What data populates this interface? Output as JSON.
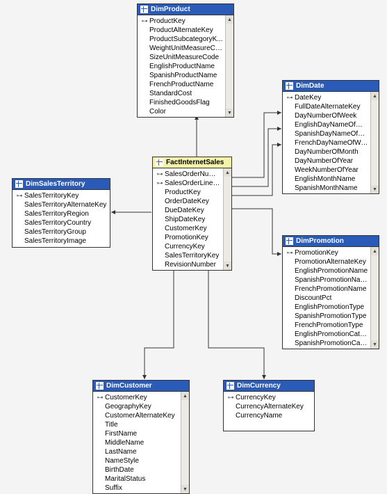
{
  "tables": {
    "dimProduct": {
      "title": "DimProduct",
      "highlight": false,
      "scrollbar": true,
      "columns": [
        {
          "key": true,
          "label": "ProductKey"
        },
        {
          "key": false,
          "label": "ProductAlternateKey"
        },
        {
          "key": false,
          "label": "ProductSubcategoryK..."
        },
        {
          "key": false,
          "label": "WeightUnitMeasureCo..."
        },
        {
          "key": false,
          "label": "SizeUnitMeasureCode"
        },
        {
          "key": false,
          "label": "EnglishProductName"
        },
        {
          "key": false,
          "label": "SpanishProductName"
        },
        {
          "key": false,
          "label": "FrenchProductName"
        },
        {
          "key": false,
          "label": "StandardCost"
        },
        {
          "key": false,
          "label": "FinishedGoodsFlag"
        },
        {
          "key": false,
          "label": "Color"
        }
      ]
    },
    "dimDate": {
      "title": "DimDate",
      "highlight": false,
      "scrollbar": true,
      "columns": [
        {
          "key": true,
          "label": "DateKey"
        },
        {
          "key": false,
          "label": "FullDateAlternateKey"
        },
        {
          "key": false,
          "label": "DayNumberOfWeek"
        },
        {
          "key": false,
          "label": "EnglishDayNameOfWeek"
        },
        {
          "key": false,
          "label": "SpanishDayNameOfWeek"
        },
        {
          "key": false,
          "label": "FrenchDayNameOfWeek"
        },
        {
          "key": false,
          "label": "DayNumberOfMonth"
        },
        {
          "key": false,
          "label": "DayNumberOfYear"
        },
        {
          "key": false,
          "label": "WeekNumberOfYear"
        },
        {
          "key": false,
          "label": "EnglishMonthName"
        },
        {
          "key": false,
          "label": "SpanishMonthName"
        }
      ]
    },
    "dimSalesTerritory": {
      "title": "DimSalesTerritory",
      "highlight": false,
      "scrollbar": false,
      "columns": [
        {
          "key": true,
          "label": "SalesTerritoryKey"
        },
        {
          "key": false,
          "label": "SalesTerritoryAlternateKey"
        },
        {
          "key": false,
          "label": "SalesTerritoryRegion"
        },
        {
          "key": false,
          "label": "SalesTerritoryCountry"
        },
        {
          "key": false,
          "label": "SalesTerritoryGroup"
        },
        {
          "key": false,
          "label": "SalesTerritoryImage"
        }
      ]
    },
    "factInternetSales": {
      "title": "FactInternetSales",
      "highlight": true,
      "scrollbar": true,
      "columns": [
        {
          "key": true,
          "label": "SalesOrderNumber"
        },
        {
          "key": true,
          "label": "SalesOrderLineNum..."
        },
        {
          "key": false,
          "label": "ProductKey"
        },
        {
          "key": false,
          "label": "OrderDateKey"
        },
        {
          "key": false,
          "label": "DueDateKey"
        },
        {
          "key": false,
          "label": "ShipDateKey"
        },
        {
          "key": false,
          "label": "CustomerKey"
        },
        {
          "key": false,
          "label": "PromotionKey"
        },
        {
          "key": false,
          "label": "CurrencyKey"
        },
        {
          "key": false,
          "label": "SalesTerritoryKey"
        },
        {
          "key": false,
          "label": "RevisionNumber"
        }
      ]
    },
    "dimPromotion": {
      "title": "DimPromotion",
      "highlight": false,
      "scrollbar": true,
      "columns": [
        {
          "key": true,
          "label": "PromotionKey"
        },
        {
          "key": false,
          "label": "PromotionAlternateKey"
        },
        {
          "key": false,
          "label": "EnglishPromotionName"
        },
        {
          "key": false,
          "label": "SpanishPromotionName"
        },
        {
          "key": false,
          "label": "FrenchPromotionName"
        },
        {
          "key": false,
          "label": "DiscountPct"
        },
        {
          "key": false,
          "label": "EnglishPromotionType"
        },
        {
          "key": false,
          "label": "SpanishPromotionType"
        },
        {
          "key": false,
          "label": "FrenchPromotionType"
        },
        {
          "key": false,
          "label": "EnglishPromotionCateg..."
        },
        {
          "key": false,
          "label": "SpanishPromotionCateg"
        }
      ]
    },
    "dimCustomer": {
      "title": "DimCustomer",
      "highlight": false,
      "scrollbar": true,
      "columns": [
        {
          "key": true,
          "label": "CustomerKey"
        },
        {
          "key": false,
          "label": "GeographyKey"
        },
        {
          "key": false,
          "label": "CustomerAlternateKey"
        },
        {
          "key": false,
          "label": "Title"
        },
        {
          "key": false,
          "label": "FirstName"
        },
        {
          "key": false,
          "label": "MiddleName"
        },
        {
          "key": false,
          "label": "LastName"
        },
        {
          "key": false,
          "label": "NameStyle"
        },
        {
          "key": false,
          "label": "BirthDate"
        },
        {
          "key": false,
          "label": "MaritalStatus"
        },
        {
          "key": false,
          "label": "Suffix"
        }
      ]
    },
    "dimCurrency": {
      "title": "DimCurrency",
      "highlight": false,
      "scrollbar": false,
      "columns": [
        {
          "key": true,
          "label": "CurrencyKey"
        },
        {
          "key": false,
          "label": "CurrencyAlternateKey"
        },
        {
          "key": false,
          "label": "CurrencyName"
        }
      ]
    }
  }
}
